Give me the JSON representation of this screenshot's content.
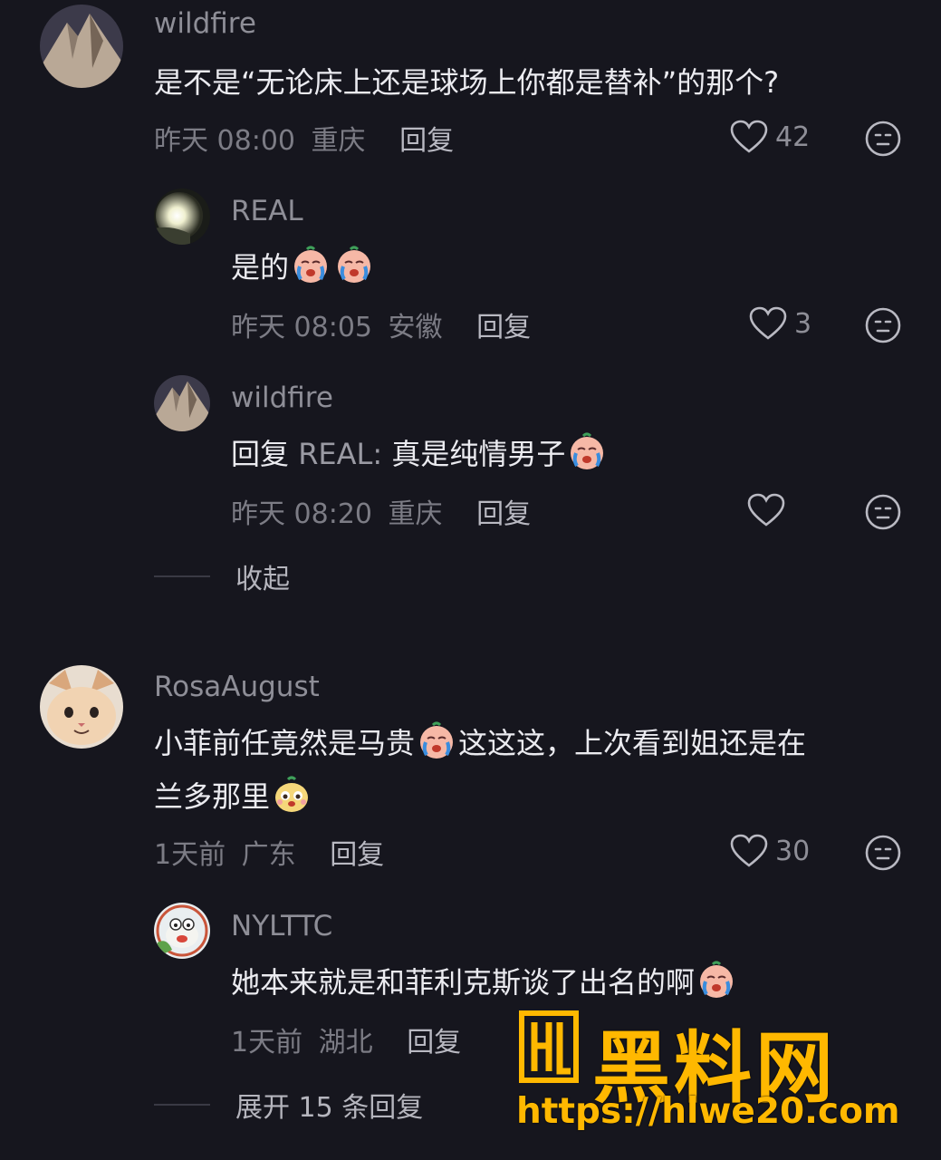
{
  "colors": {
    "background": "#16161e",
    "username": "#8e8e97",
    "text": "#ebebf0",
    "meta": "#7c7c85",
    "watermark": "#ffb800"
  },
  "comments": [
    {
      "username": "wildfire",
      "text": "是不是“无论床上还是球场上你都是替补”的那个?",
      "time": "昨天 08:00",
      "location": "重庆",
      "reply_label": "回复",
      "likes": "42",
      "avatar_icon": "mountain-avatar"
    },
    {
      "username": "REAL",
      "text_before": "是的",
      "emojis": [
        "crying-face-emoji",
        "crying-face-emoji"
      ],
      "time": "昨天 08:05",
      "location": "安徽",
      "reply_label": "回复",
      "likes": "3",
      "avatar_icon": "light-avatar"
    },
    {
      "username": "wildfire",
      "text_before": "回复 ",
      "reply_target": "REAL:",
      "text_after": " 真是纯情男子",
      "emojis": [
        "crying-face-emoji"
      ],
      "time": "昨天 08:20",
      "location": "重庆",
      "reply_label": "回复",
      "likes": "",
      "avatar_icon": "mountain-avatar"
    },
    {
      "username": "RosaAugust",
      "text_line1_a": "小菲前任竟然是马贵",
      "text_line1_b": "这这这，上次看到姐还是在",
      "text_line2": "兰多那里",
      "emojis": [
        "crying-face-emoji",
        "peeking-face-emoji"
      ],
      "time": "1天前",
      "location": "广东",
      "reply_label": "回复",
      "likes": "30",
      "avatar_icon": "cat-avatar"
    },
    {
      "username": "NYLTTC",
      "text_before": "她本来就是和菲利克斯谈了出名的啊",
      "emojis": [
        "crying-face-emoji"
      ],
      "time": "1天前",
      "location": "湖北",
      "reply_label": "回复",
      "likes": "",
      "avatar_icon": "frog-avatar"
    }
  ],
  "collapse_label": "收起",
  "expand_label": "展开 15 条回复",
  "watermark": {
    "word": "黑料网",
    "url": "https://hlwe20.com"
  }
}
